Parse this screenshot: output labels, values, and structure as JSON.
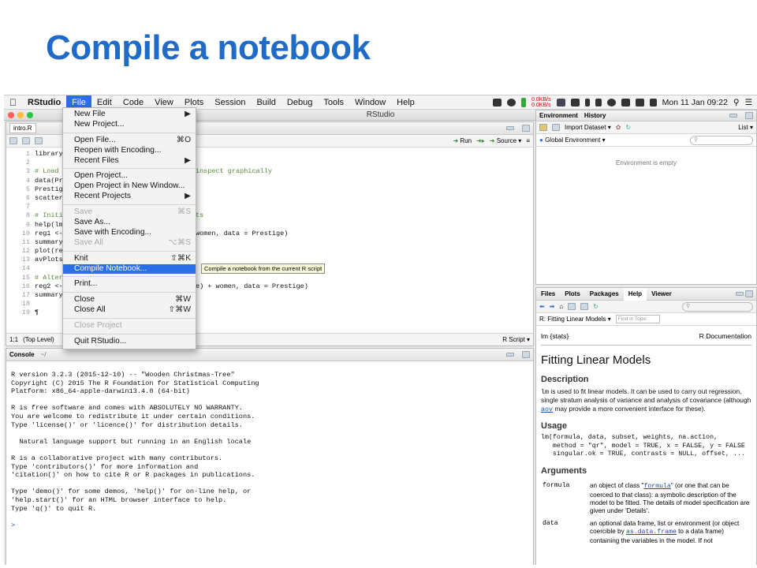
{
  "slide": {
    "title": "Compile a notebook"
  },
  "menubar": {
    "apple": "",
    "items": [
      "RStudio",
      "File",
      "Edit",
      "Code",
      "View",
      "Plots",
      "Session",
      "Build",
      "Debug",
      "Tools",
      "Window",
      "Help"
    ],
    "net_up": "0.0KB/s",
    "net_down": "0.0KB/s",
    "clock": "Mon 11 Jan  09:22"
  },
  "window": {
    "title": "RStudio"
  },
  "file_menu": {
    "items": [
      {
        "label": "New File",
        "shortcut": "▶"
      },
      {
        "label": "New Project...",
        "shortcut": ""
      },
      {
        "label": "Open File...",
        "shortcut": "⌘O"
      },
      {
        "label": "Reopen with Encoding...",
        "shortcut": ""
      },
      {
        "label": "Recent Files",
        "shortcut": "▶"
      },
      {
        "label": "Open Project...",
        "shortcut": ""
      },
      {
        "label": "Open Project in New Window...",
        "shortcut": ""
      },
      {
        "label": "Recent Projects",
        "shortcut": "▶"
      },
      {
        "label": "Save",
        "shortcut": "⌘S"
      },
      {
        "label": "Save As...",
        "shortcut": ""
      },
      {
        "label": "Save with Encoding...",
        "shortcut": ""
      },
      {
        "label": "Save All",
        "shortcut": "⌥⌘S"
      },
      {
        "label": "Knit",
        "shortcut": "⇧⌘K"
      },
      {
        "label": "Compile Notebook...",
        "shortcut": ""
      },
      {
        "label": "Print...",
        "shortcut": ""
      },
      {
        "label": "Close",
        "shortcut": "⌘W"
      },
      {
        "label": "Close All",
        "shortcut": "⇧⌘W"
      },
      {
        "label": "Close Project",
        "shortcut": ""
      },
      {
        "label": "Quit RStudio...",
        "shortcut": ""
      }
    ],
    "tooltip": "Compile a notebook from the current R script"
  },
  "editor": {
    "tab": "intro.R",
    "run_label": "Run",
    "source_label": "Source",
    "line_numbers": [
      "1",
      "2",
      "3",
      "4",
      "5",
      "6",
      "7",
      "8",
      "9",
      "10",
      "11",
      "12",
      "13",
      "14",
      "15",
      "16",
      "17",
      "18",
      "19"
    ],
    "code_visible_left": [
      "library(",
      "",
      "# Load t",
      "data(Pre",
      "Prestige",
      "scatterp",
      "",
      "# Initia",
      "help(lm)",
      "reg1 <-",
      "summary(",
      "plot(reg",
      "avPlots(",
      "",
      "# Altern",
      "reg2 <-",
      "summary(",
      "",
      "¶"
    ],
    "code_visible_right": [
      "",
      "",
      "inspect graphically",
      "",
      "",
      "",
      "",
      "ts",
      "",
      "women, data = Prestige)",
      "",
      "",
      "",
      "",
      "",
      "e) + women, data = Prestige)",
      "",
      "",
      ""
    ],
    "status_pos": "1:1",
    "status_scope": "(Top Level)",
    "status_type": "R Script"
  },
  "console": {
    "title": "Console",
    "path": "~/",
    "lines": [
      "R version 3.2.3 (2015-12-10) -- \"Wooden Christmas-Tree\"",
      "Copyright (C) 2015 The R Foundation for Statistical Computing",
      "Platform: x86_64-apple-darwin13.4.0 (64-bit)",
      "",
      "R is free software and comes with ABSOLUTELY NO WARRANTY.",
      "You are welcome to redistribute it under certain conditions.",
      "Type 'license()' or 'licence()' for distribution details.",
      "",
      "  Natural language support but running in an English locale",
      "",
      "R is a collaborative project with many contributors.",
      "Type 'contributors()' for more information and",
      "'citation()' on how to cite R or R packages in publications.",
      "",
      "Type 'demo()' for some demos, 'help()' for on-line help, or",
      "'help.start()' for an HTML browser interface to help.",
      "Type 'q()' to quit R.",
      "",
      ">"
    ]
  },
  "environment": {
    "tabs": [
      "Environment",
      "History"
    ],
    "import_label": "Import Dataset",
    "list_label": "List",
    "scope": "Global Environment",
    "empty_msg": "Environment is empty"
  },
  "help": {
    "tabs": [
      "Files",
      "Plots",
      "Packages",
      "Help",
      "Viewer"
    ],
    "topic": "R: Fitting Linear Models",
    "find_placeholder": "Find in Topic",
    "lm_stats": "lm {stats}",
    "r_doc": "R Documentation",
    "title": "Fitting Linear Models",
    "desc_h": "Description",
    "desc_p1": " is used to fit linear models. It can be used to carry out regression, single stratum analysis of variance and analysis of covariance (although ",
    "desc_code": "lm",
    "desc_link": "aov",
    "desc_p2": " may provide a more convenient interface for these).",
    "usage_h": "Usage",
    "usage_code": "lm(formula, data, subset, weights, na.action,\n   method = \"qr\", model = TRUE, x = FALSE, y = FALSE\n   singular.ok = TRUE, contrasts = NULL, offset, ...",
    "args_h": "Arguments",
    "arg1_name": "formula",
    "arg1_a": "an object of class \"",
    "arg1_link": "formula",
    "arg1_b": "\" (or one that can be coerced to that class): a symbolic description of the model to be fitted. The details of model specification are given under 'Details'.",
    "arg2_name": "data",
    "arg2_a": "an optional data frame, list or environment (or object coercible by ",
    "arg2_link": "as.data.frame",
    "arg2_b": " to a data frame) containing the variables in the model. If not"
  }
}
